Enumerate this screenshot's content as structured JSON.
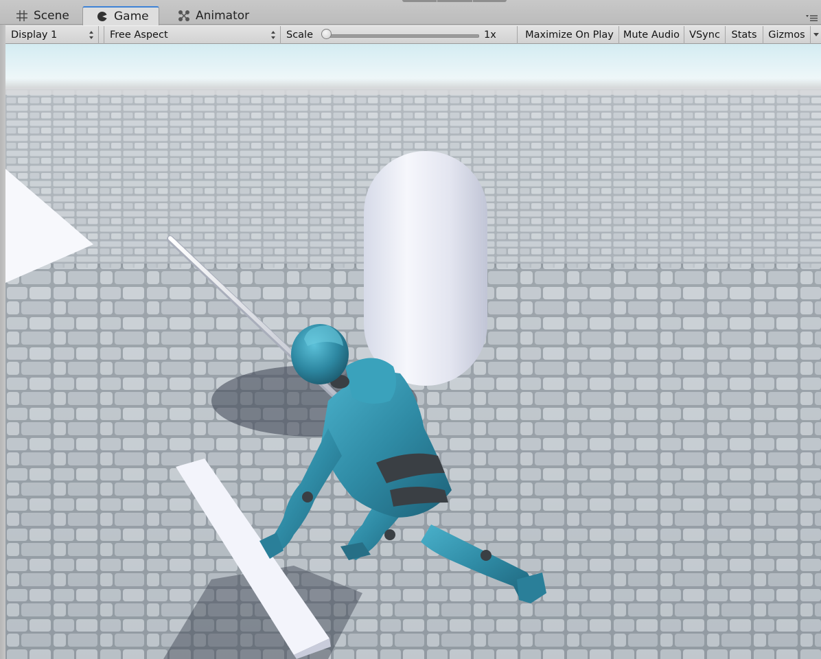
{
  "tabs": [
    {
      "label": "Scene",
      "icon": "grid-icon",
      "active": false
    },
    {
      "label": "Game",
      "icon": "pacman-icon",
      "active": true
    },
    {
      "label": "Animator",
      "icon": "animator-nodes-icon",
      "active": false
    }
  ],
  "toolbar": {
    "display": "Display 1",
    "aspect": "Free Aspect",
    "scale_label": "Scale",
    "scale_value": "1x",
    "scale_fraction": 0.0,
    "maximize_on_play": "Maximize On Play",
    "mute_audio": "Mute Audio",
    "vsync": "VSync",
    "stats": "Stats",
    "gizmos": "Gizmos"
  },
  "colors": {
    "active_tab_accent": "#3d82d6",
    "character_teal": "#2f8ba5",
    "character_joint": "#3a3f44",
    "ground_stone": "#b9c0c7",
    "sky": "#e6f2f6"
  }
}
